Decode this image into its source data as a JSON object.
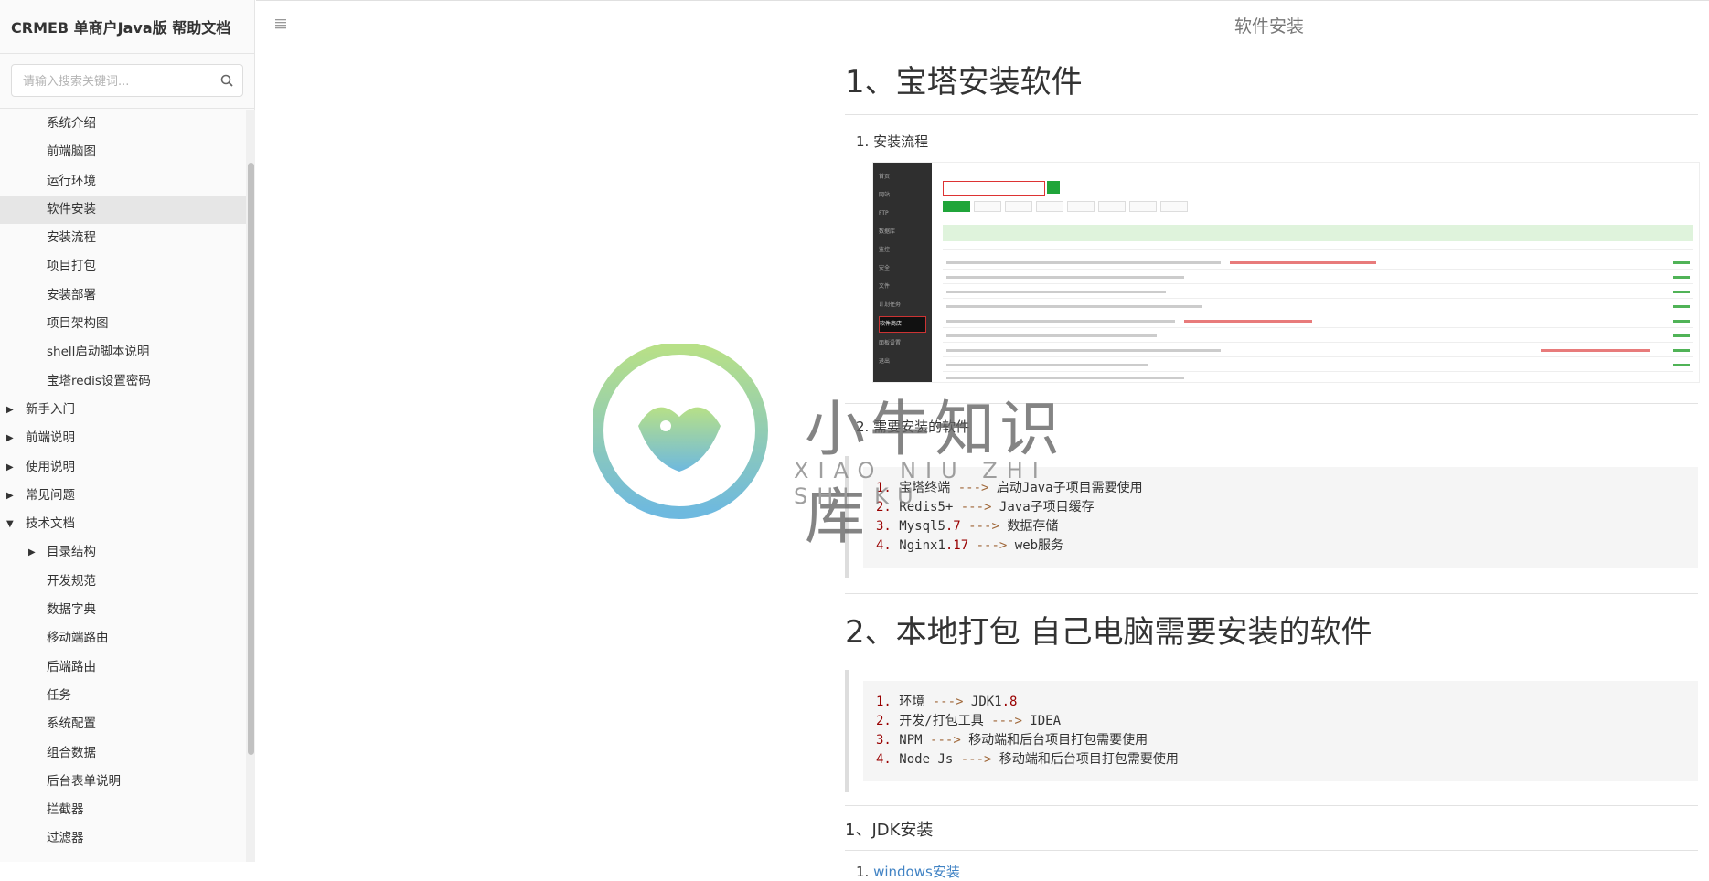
{
  "sidebar": {
    "title": "CRMEB 单商户Java版 帮助文档",
    "search_placeholder": "请输入搜索关键词...",
    "items": [
      {
        "label": "系统介绍"
      },
      {
        "label": "前端脑图"
      },
      {
        "label": "运行环境"
      },
      {
        "label": "软件安装"
      },
      {
        "label": "安装流程"
      },
      {
        "label": "项目打包"
      },
      {
        "label": "安装部署"
      },
      {
        "label": "项目架构图"
      },
      {
        "label": "shell启动脚本说明"
      },
      {
        "label": "宝塔redis设置密码"
      },
      {
        "label": "新手入门"
      },
      {
        "label": "前端说明"
      },
      {
        "label": "使用说明"
      },
      {
        "label": "常见问题"
      },
      {
        "label": "技术文档"
      },
      {
        "label": "目录结构"
      },
      {
        "label": "开发规范"
      },
      {
        "label": "数据字典"
      },
      {
        "label": "移动端路由"
      },
      {
        "label": "后端路由"
      },
      {
        "label": "任务"
      },
      {
        "label": "系统配置"
      },
      {
        "label": "组合数据"
      },
      {
        "label": "后台表单说明"
      },
      {
        "label": "拦截器"
      },
      {
        "label": "过滤器"
      }
    ]
  },
  "header": {
    "title": "软件安装"
  },
  "content": {
    "h1_1": "1、宝塔安装软件",
    "list1_item1": "1. 安装流程",
    "list1_item2": "2. 需要安装的软件",
    "code1": [
      {
        "num": "1.",
        "name": "宝塔终端",
        "arrow": "--->",
        "desc": "启动Java子项目需要使用"
      },
      {
        "num": "2.",
        "name": "Redis5+",
        "arrow": "--->",
        "desc": "Java子项目缓存"
      },
      {
        "num": "3.",
        "name": "Mysql5",
        "ver": ".7",
        "arrow": "--->",
        "desc": "数据存储"
      },
      {
        "num": "4.",
        "name": "Nginx1",
        "ver": ".17",
        "arrow": "--->",
        "desc": "web服务"
      }
    ],
    "h1_2": "2、本地打包 自己电脑需要安装的软件",
    "code2": [
      {
        "num": "1.",
        "name": "环境",
        "arrow": "--->",
        "desc": "JDK1",
        "ver": ".8"
      },
      {
        "num": "2.",
        "name": "开发/打包工具",
        "arrow": "--->",
        "desc": "IDEA"
      },
      {
        "num": "3.",
        "name": "NPM",
        "arrow": "--->",
        "desc": "移动端和后台项目打包需要使用"
      },
      {
        "num": "4.",
        "name": "Node Js ",
        "arrow": "--->",
        "desc": "移动端和后台项目打包需要使用"
      }
    ],
    "h2_1": "1、JDK安装",
    "link1_num": "1.",
    "link1": "windows安装"
  },
  "screenshot": {
    "menu": [
      "首页",
      "网站",
      "FTP",
      "数据库",
      "监控",
      "安全",
      "文件",
      "计划任务",
      "软件商店",
      "面板设置",
      "退出"
    ],
    "selected_index": 8
  },
  "watermark": {
    "text": "小牛知识库",
    "sub": "XIAO NIU ZHI SHI KU"
  }
}
